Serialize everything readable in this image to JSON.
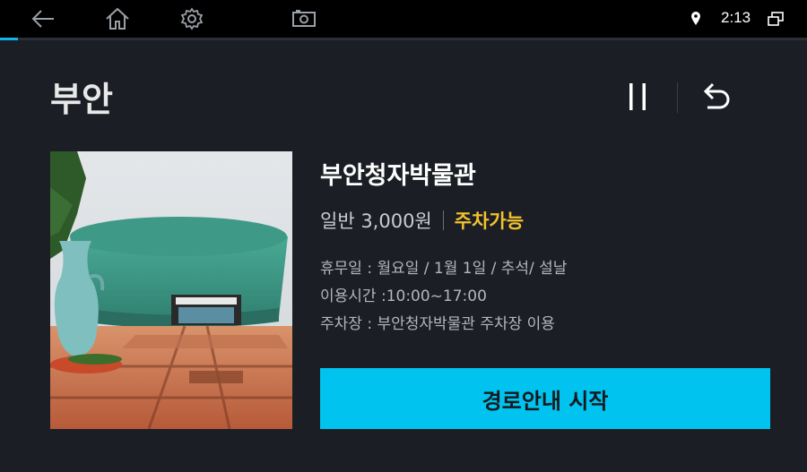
{
  "statusbar": {
    "back_icon": "back-arrow-icon",
    "home_icon": "home-icon",
    "settings_icon": "gear-icon",
    "screenshot_icon": "camera-icon",
    "location_icon": "location-pin-icon",
    "time": "2:13",
    "window_icon": "window-switch-icon"
  },
  "progress": {
    "fraction": 0.022,
    "color": "#10b4e8"
  },
  "header": {
    "title": "부안",
    "pause_icon": "pause-icon",
    "back_icon": "undo-back-icon"
  },
  "poi": {
    "name": "부안청자박물관",
    "price": "일반 3,000원",
    "parking": "주차가능",
    "closed_days": "휴무일 : 월요일 / 1월 1일 / 추석/ 설날",
    "hours": "이용시간 :10:00~17:00",
    "parking_info": "주차장 : 부안청자박물관 주차장 이용",
    "photo_icon": "museum-photo"
  },
  "cta": {
    "label": "경로안내 시작",
    "color": "#00c3ef"
  }
}
